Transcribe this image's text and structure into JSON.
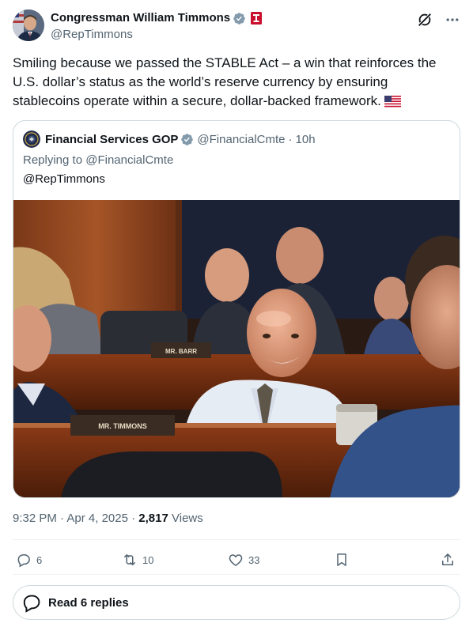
{
  "author": {
    "display_name": "Congressman William Timmons",
    "handle": "@RepTimmons",
    "verified_icon": "verified-badge-icon",
    "affiliation_icon": "congress-badge-icon"
  },
  "tweet": {
    "text": "Smiling because we passed the STABLE Act – a win that reinforces the U.S. dollar’s status as the world’s reserve currency by ensuring stablecoins operate within a secure, dollar-backed framework.",
    "emoji": "🇺🇸"
  },
  "quote": {
    "display_name": "Financial Services GOP",
    "handle": "@FinancialCmte",
    "time": "10h",
    "replying_prefix": "Replying to",
    "replying_to": "@FinancialCmte",
    "body": "@RepTimmons",
    "photo": {
      "nameplate_left": "MR. TIMMONS",
      "nameplate_back": "MR. BARR"
    }
  },
  "meta": {
    "time": "9:32 PM",
    "date": "Apr 4, 2025",
    "views_count": "2,817",
    "views_label": "Views",
    "separator": "·"
  },
  "actions": {
    "replies": "6",
    "reposts": "10",
    "likes": "33"
  },
  "read_replies_label": "Read 6 replies",
  "colors": {
    "text": "#0f1419",
    "secondary": "#536471",
    "border": "#cfd9de",
    "verified": "#829aab"
  }
}
